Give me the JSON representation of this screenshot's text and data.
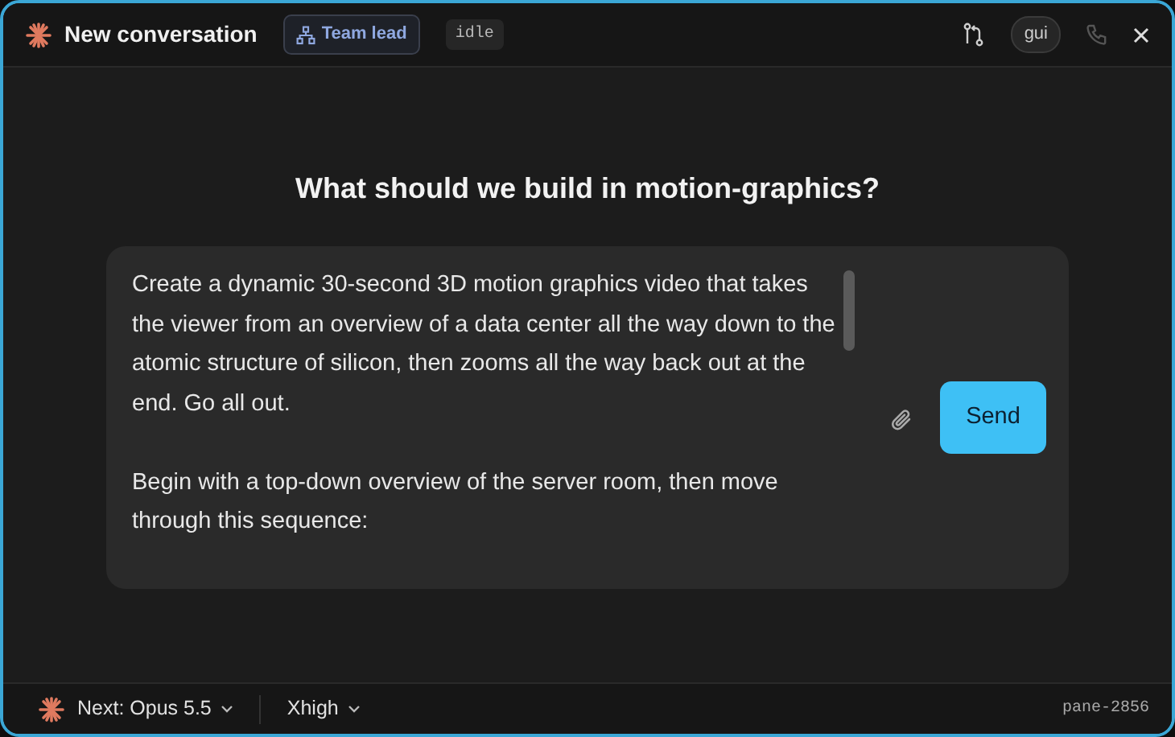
{
  "header": {
    "title": "New conversation",
    "role_badge": "Team lead",
    "status": "idle",
    "chip": "gui"
  },
  "heading": "What should we build in motion-graphics?",
  "composer": {
    "text": "Create a dynamic 30-second 3D motion graphics video that takes the viewer from an overview of a data center all the way down to the atomic structure of silicon, then zooms all the way back out at the end. Go all out.\n\nBegin with a top-down overview of the server room, then move through this sequence:",
    "send": "Send"
  },
  "footer": {
    "model": "Next: Opus 5.5",
    "effort": "Xhigh",
    "pane": "pane-2856"
  }
}
